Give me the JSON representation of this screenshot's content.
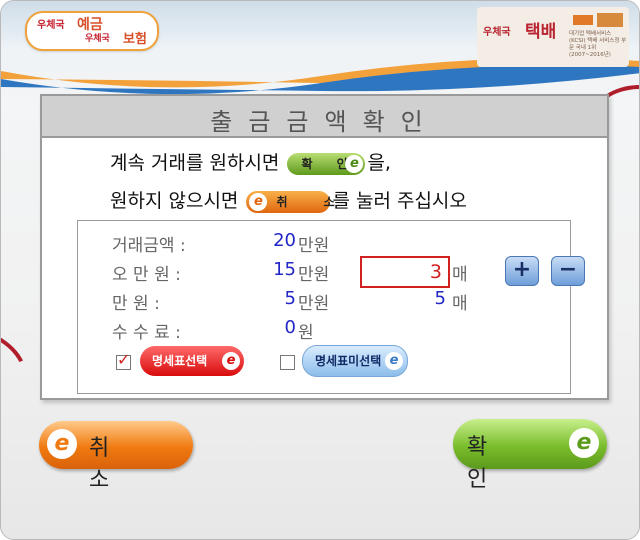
{
  "header": {
    "left_logo": {
      "line1": "우체국",
      "line2": "예금",
      "line3": "우체국",
      "line4": "보험"
    },
    "right_logo": {
      "line1": "우체국",
      "line2": "택배",
      "info": "대기업 택배서비스(KCSI) 택배 서비스정 부문 국내 1위 (2007~2016년)"
    }
  },
  "panel": {
    "title": "출금금액확인",
    "message_line1_pre": "계속 거래를 원하시면",
    "message_line1_post": "을,",
    "message_line2_pre": "원하지 않으시면",
    "message_line2_post": "를 눌러 주십시오",
    "inline_confirm_label": "확 인",
    "inline_cancel_label": "취 소",
    "e_glyph": "e"
  },
  "details": {
    "rows": [
      {
        "label": "거래금액 :",
        "value": "20",
        "unit": "만원"
      },
      {
        "label": "오 만 원 :",
        "value": "15",
        "unit": "만원"
      },
      {
        "label": "만     원 :",
        "value": "5",
        "unit": "만원"
      },
      {
        "label": "수 수 료 :",
        "value": "0",
        "unit": "원"
      }
    ],
    "fifty_k_qty": "3",
    "ten_k_qty": "5",
    "count_unit": "매",
    "plus_label": "+",
    "minus_label": "−"
  },
  "statement": {
    "select_label": "명세표선택",
    "select_checked": true,
    "no_select_label": "명세표미선택",
    "no_select_checked": false
  },
  "buttons": {
    "cancel_label": "취소",
    "confirm_label": "확인"
  },
  "colors": {
    "accent_red": "#d12020",
    "value_blue": "#2226c6",
    "confirm_green": "#7abd2c",
    "cancel_orange": "#f07a10"
  }
}
